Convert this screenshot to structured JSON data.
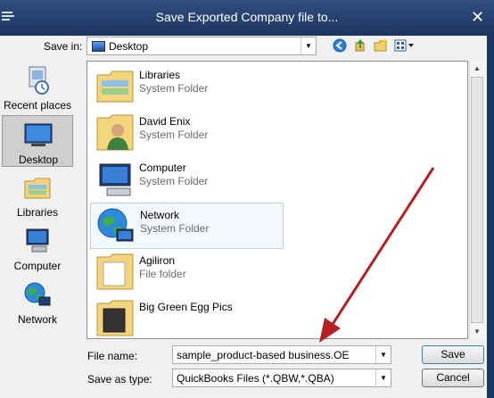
{
  "window": {
    "title": "Save Exported Company file to..."
  },
  "save_in": {
    "label": "Save in:",
    "value": "Desktop"
  },
  "places": [
    {
      "label": "Recent places",
      "icon": "recent-places-icon"
    },
    {
      "label": "Desktop",
      "icon": "desktop-icon",
      "selected": true
    },
    {
      "label": "Libraries",
      "icon": "libraries-icon"
    },
    {
      "label": "Computer",
      "icon": "computer-icon"
    },
    {
      "label": "Network",
      "icon": "network-icon"
    }
  ],
  "files": [
    {
      "name": "Libraries",
      "type": "System Folder",
      "icon": "libraries-folder-icon"
    },
    {
      "name": "David Enix",
      "type": "System Folder",
      "icon": "user-folder-icon"
    },
    {
      "name": "Computer",
      "type": "System Folder",
      "icon": "computer-icon"
    },
    {
      "name": "Network",
      "type": "System Folder",
      "icon": "network-icon",
      "highlighted": true
    },
    {
      "name": "Agiliron",
      "type": "File folder",
      "icon": "folder-icon"
    },
    {
      "name": "Big Green Egg Pics",
      "type": "",
      "icon": "folder-icon"
    }
  ],
  "file_name": {
    "label": "File name:",
    "value": "sample_product-based business.OE"
  },
  "save_as_type": {
    "label": "Save as type:",
    "value": "QuickBooks Files (*.QBW,*.QBA)"
  },
  "buttons": {
    "save": "Save",
    "cancel": "Cancel"
  },
  "colors": {
    "title_bar": "#1d3561",
    "arrow_annotation": "#b22222"
  }
}
